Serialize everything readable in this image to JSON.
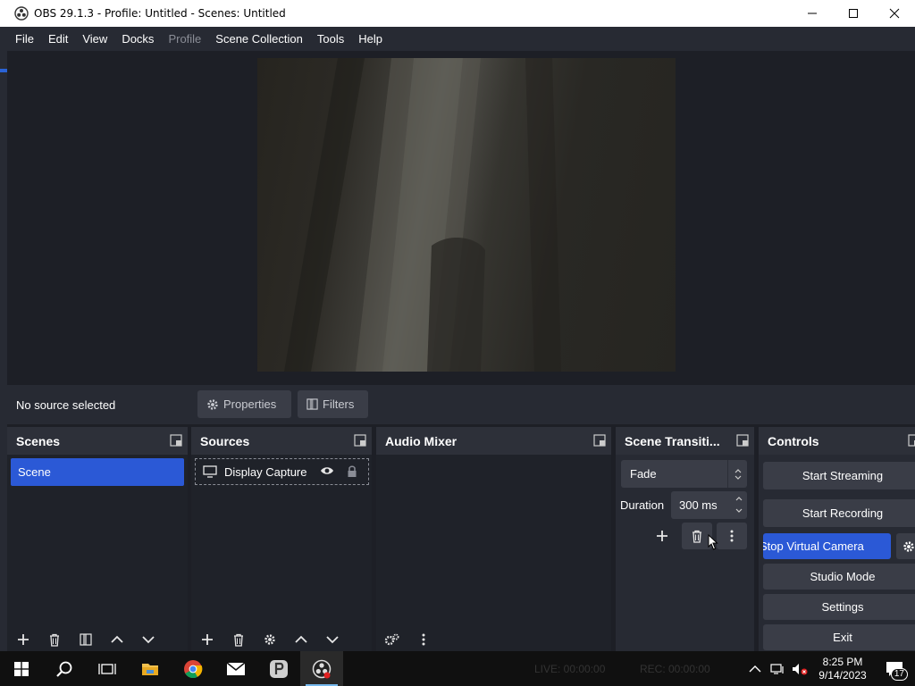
{
  "window": {
    "title": "OBS 29.1.3 - Profile: Untitled - Scenes: Untitled"
  },
  "menu": {
    "items": [
      "File",
      "Edit",
      "View",
      "Docks",
      "Profile",
      "Scene Collection",
      "Tools",
      "Help"
    ]
  },
  "context_bar": {
    "status": "No source selected",
    "properties_label": "Properties",
    "filters_label": "Filters"
  },
  "scenes": {
    "title": "Scenes",
    "items": [
      "Scene"
    ]
  },
  "sources": {
    "title": "Sources",
    "items": [
      {
        "label": "Display Capture",
        "icon": "monitor-icon"
      }
    ]
  },
  "audio_mixer": {
    "title": "Audio Mixer"
  },
  "transitions": {
    "title": "Scene Transiti...",
    "selected": "Fade",
    "duration_label": "Duration",
    "duration_value": "300 ms"
  },
  "controls": {
    "title": "Controls",
    "start_streaming": "Start Streaming",
    "start_recording": "Start Recording",
    "virtual_camera": "Stop Virtual Camera",
    "studio_mode": "Studio Mode",
    "settings": "Settings",
    "exit": "Exit"
  },
  "statusbar": {
    "live": "LIVE: 00:00:00",
    "rec": "REC: 00:00:00"
  },
  "taskbar": {
    "time": "8:25 PM",
    "date": "9/14/2023",
    "notification_count": "17"
  },
  "colors": {
    "accent": "#2b59d6",
    "panel": "#272a33",
    "background": "#1d1f26"
  }
}
